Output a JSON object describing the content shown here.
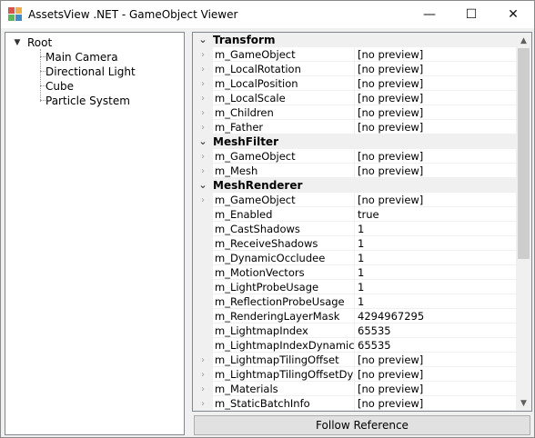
{
  "window": {
    "title": "AssetsView .NET - GameObject Viewer",
    "controls": {
      "minimize": "—",
      "maximize": "☐",
      "close": "✕"
    }
  },
  "tree": {
    "root": {
      "label": "Root",
      "expanded": true
    },
    "children": [
      "Main Camera",
      "Directional Light",
      "Cube",
      "Particle System"
    ]
  },
  "properties": {
    "categories": [
      {
        "name": "Transform",
        "rows": [
          {
            "name": "m_GameObject",
            "value": "[no preview]",
            "expandable": true
          },
          {
            "name": "m_LocalRotation",
            "value": "[no preview]",
            "expandable": true
          },
          {
            "name": "m_LocalPosition",
            "value": "[no preview]",
            "expandable": true
          },
          {
            "name": "m_LocalScale",
            "value": "[no preview]",
            "expandable": true
          },
          {
            "name": "m_Children",
            "value": "[no preview]",
            "expandable": true
          },
          {
            "name": "m_Father",
            "value": "[no preview]",
            "expandable": true
          }
        ]
      },
      {
        "name": "MeshFilter",
        "rows": [
          {
            "name": "m_GameObject",
            "value": "[no preview]",
            "expandable": true
          },
          {
            "name": "m_Mesh",
            "value": "[no preview]",
            "expandable": true
          }
        ]
      },
      {
        "name": "MeshRenderer",
        "rows": [
          {
            "name": "m_GameObject",
            "value": "[no preview]",
            "expandable": true
          },
          {
            "name": "m_Enabled",
            "value": "true",
            "expandable": false
          },
          {
            "name": "m_CastShadows",
            "value": "1",
            "expandable": false
          },
          {
            "name": "m_ReceiveShadows",
            "value": "1",
            "expandable": false
          },
          {
            "name": "m_DynamicOccludee",
            "value": "1",
            "expandable": false
          },
          {
            "name": "m_MotionVectors",
            "value": "1",
            "expandable": false
          },
          {
            "name": "m_LightProbeUsage",
            "value": "1",
            "expandable": false
          },
          {
            "name": "m_ReflectionProbeUsage",
            "value": "1",
            "expandable": false
          },
          {
            "name": "m_RenderingLayerMask",
            "value": "4294967295",
            "expandable": false
          },
          {
            "name": "m_LightmapIndex",
            "value": "65535",
            "expandable": false
          },
          {
            "name": "m_LightmapIndexDynamic",
            "value": "65535",
            "expandable": false
          },
          {
            "name": "m_LightmapTilingOffset",
            "value": "[no preview]",
            "expandable": true
          },
          {
            "name": "m_LightmapTilingOffsetDynamic",
            "value": "[no preview]",
            "expandable": true
          },
          {
            "name": "m_Materials",
            "value": "[no preview]",
            "expandable": true
          },
          {
            "name": "m_StaticBatchInfo",
            "value": "[no preview]",
            "expandable": true
          }
        ]
      }
    ]
  },
  "buttons": {
    "follow_reference": "Follow Reference"
  }
}
